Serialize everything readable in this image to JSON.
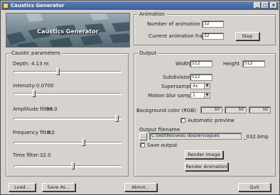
{
  "window": {
    "title": "Caustics Generator"
  },
  "banner": {
    "text": "Caustics Generator"
  },
  "animation": {
    "group_label": "Animation",
    "frames_label": "Number of animation frames",
    "frames_value": "32",
    "current_label": "Current animation frame",
    "current_value": "32",
    "step_label": "Step"
  },
  "caustic": {
    "group_label": "Caustic parameters",
    "depth": {
      "label": "Depth:",
      "value": "4.13 m",
      "level": 0.41
    },
    "intensity": {
      "label": "Intensity:",
      "value": "0.0700",
      "level": 0.18
    },
    "amplitude": {
      "label": "Amplitude filter:",
      "value": "99.0",
      "level": 0.97
    },
    "frequency": {
      "label": "Frequency filter:",
      "value": "3.2",
      "level": 0.65
    },
    "time": {
      "label": "Time filter:",
      "value": "32.0",
      "level": 0.55
    }
  },
  "output": {
    "group_label": "Output",
    "width_label": "Width",
    "width_value": "512",
    "height_label": "Height",
    "height_value": "512",
    "subdiv_label": "Subdivisions",
    "subdiv_value": "512",
    "supersampling_label": "Supersampling",
    "supersampling_value": "4x",
    "motion_label": "Motion blur samples",
    "motion_value": "1",
    "bg_label": "Background color (RGB)",
    "bg_r": "50",
    "bg_g": "50",
    "bg_b": "50",
    "auto_preview_label": "Automatic preview",
    "filename_label": "Output filename",
    "filename_value": "C:\\test\\Nouveau dossier\\vagues",
    "filename_suffix": "_032.bmp",
    "save_output_label": "Save output",
    "render_image_label": "Render Image",
    "render_animation_label": "Render Animation"
  },
  "footer": {
    "load_label": "Load...",
    "save_as_label": "Save As...",
    "about_label": "About...",
    "quit_label": "Quit"
  },
  "colors": {
    "title_bar": "#3f5f95",
    "window_bg": "#d6d3ce",
    "desktop": "#4b5560"
  }
}
